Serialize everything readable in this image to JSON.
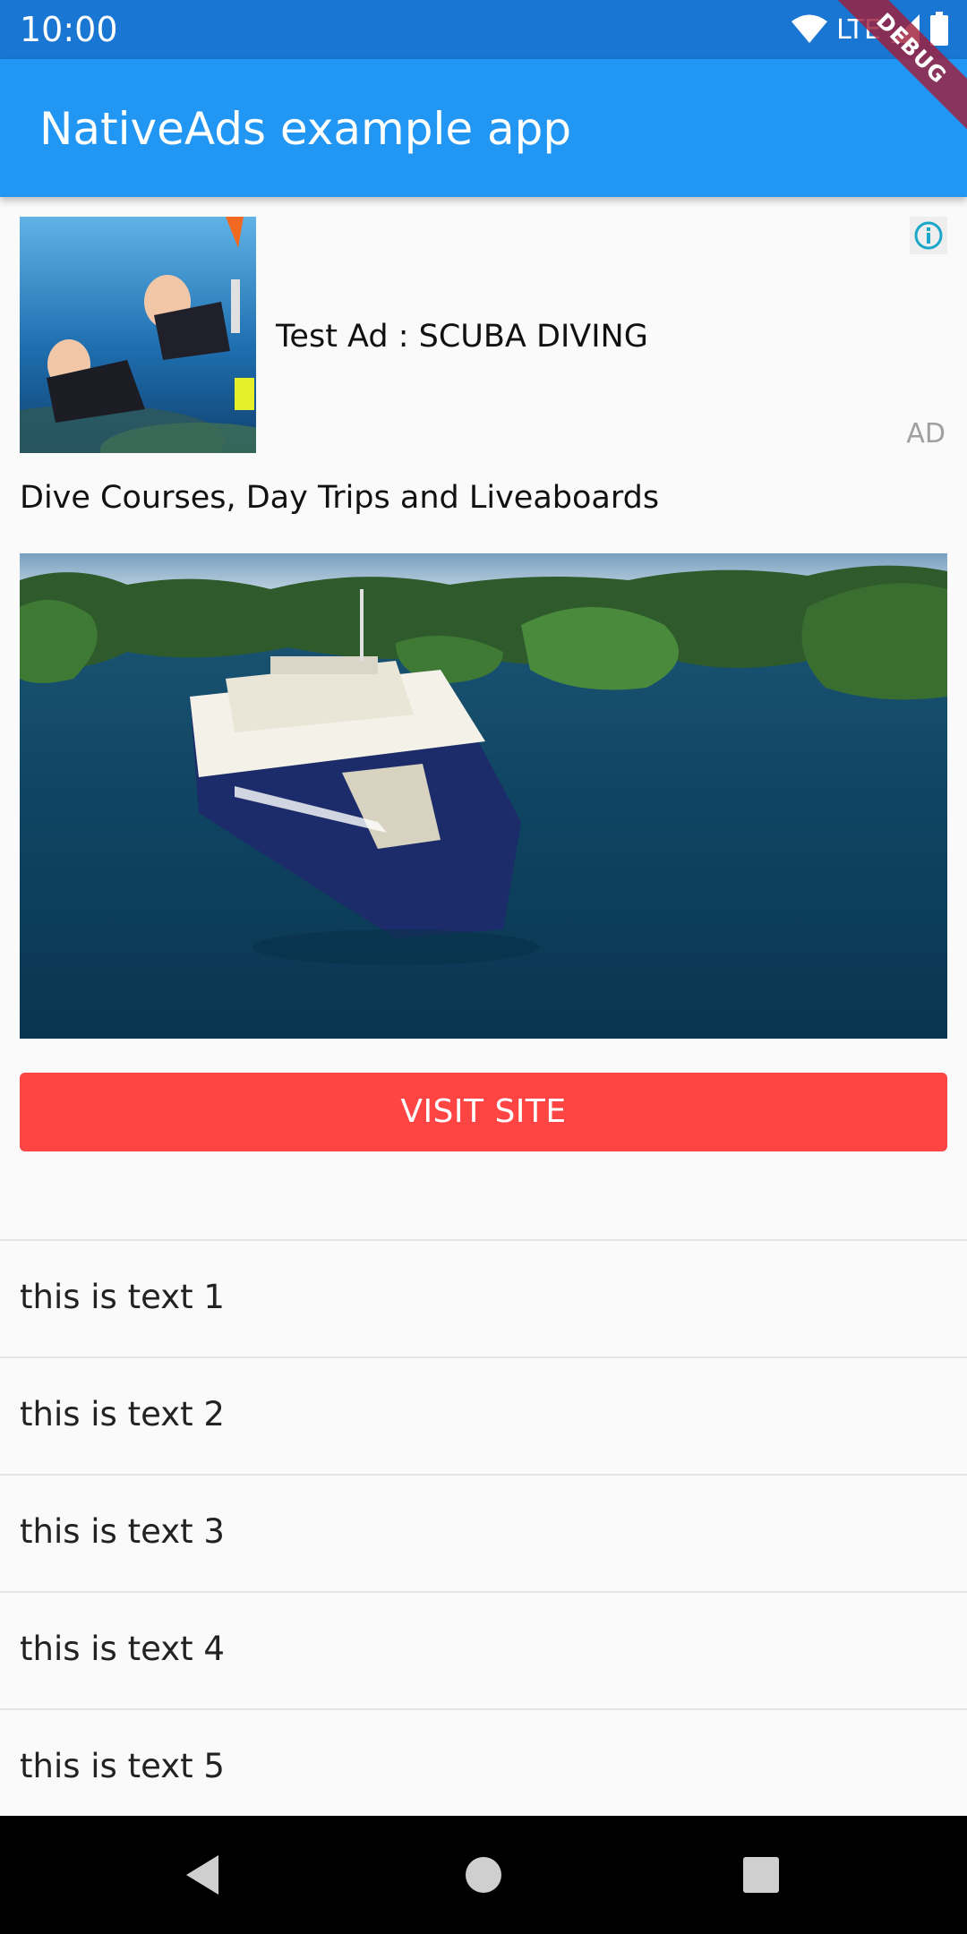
{
  "status_bar": {
    "time": "10:00",
    "network": "LTE",
    "icons": [
      "wifi-icon",
      "cellular-signal-icon",
      "battery-icon"
    ]
  },
  "debug_banner": "DEBUG",
  "app_bar": {
    "title": "NativeAds example app",
    "color": "#2196f3"
  },
  "ad": {
    "headline": "Test Ad : SCUBA DIVING",
    "badge": "AD",
    "body": "Dive Courses, Day Trips and Liveaboards",
    "cta_label": "VISIT SITE",
    "cta_color": "#ff4444",
    "adchoices_icon": "info-icon"
  },
  "list": {
    "items": [
      "this is text 1",
      "this is text 2",
      "this is text 3",
      "this is text 4",
      "this is text 5"
    ]
  },
  "nav_bar": {
    "icons": [
      "back-icon",
      "home-icon",
      "recents-icon"
    ]
  }
}
